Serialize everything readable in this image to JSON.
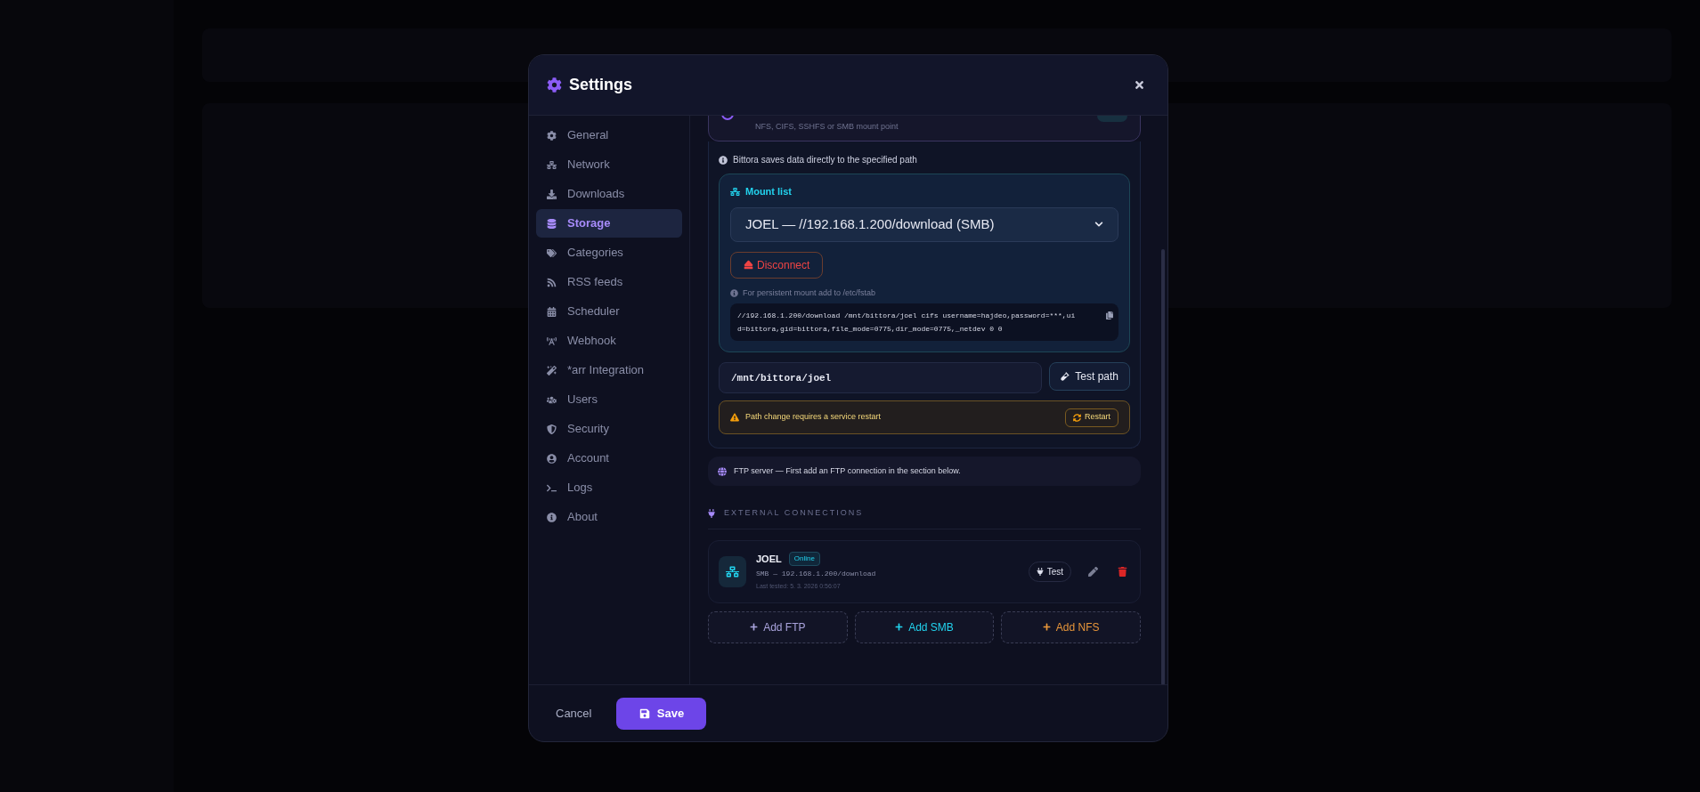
{
  "dialog": {
    "title": "Settings"
  },
  "sidebar": {
    "items": [
      {
        "label": "General",
        "selected": false
      },
      {
        "label": "Network",
        "selected": false
      },
      {
        "label": "Downloads",
        "selected": false
      },
      {
        "label": "Storage",
        "selected": true
      },
      {
        "label": "Categories",
        "selected": false
      },
      {
        "label": "RSS feeds",
        "selected": false
      },
      {
        "label": "Scheduler",
        "selected": false
      },
      {
        "label": "Webhook",
        "selected": false
      },
      {
        "label": "*arr Integration",
        "selected": false
      },
      {
        "label": "Users",
        "selected": false
      },
      {
        "label": "Security",
        "selected": false
      },
      {
        "label": "Account",
        "selected": false
      },
      {
        "label": "Logs",
        "selected": false
      },
      {
        "label": "About",
        "selected": false
      }
    ]
  },
  "storage": {
    "option_hint": "NFS, CIFS, SSHFS or SMB mount point",
    "info": "Bittora saves data directly to the specified path",
    "mount_list": {
      "title": "Mount list",
      "selected_mount": "JOEL — //192.168.1.200/download (SMB)",
      "disconnect": "Disconnect",
      "fstab_hint": "For persistent mount add to /etc/fstab",
      "fstab_line": "//192.168.1.200/download /mnt/bittora/joel cifs username=hajdeo,password=***,uid=bittora,gid=bittora,file_mode=0775,dir_mode=0775,_netdev 0 0"
    },
    "path": {
      "value": "/mnt/bittora/joel",
      "test_button": "Test path"
    },
    "warning": {
      "text": "Path change requires a service restart",
      "button": "Restart"
    },
    "ftp_option": "FTP server — First add an FTP connection in the section below."
  },
  "external": {
    "heading": "EXTERNAL CONNECTIONS",
    "connections": [
      {
        "name": "JOEL",
        "status": "Online",
        "detail": "SMB — 192.168.1.200/download",
        "last_tested": "Last tested: 5. 3. 2026 0:56:07",
        "test": "Test"
      }
    ],
    "add_buttons": [
      {
        "label": "Add FTP",
        "color": "#a9a3dc"
      },
      {
        "label": "Add SMB",
        "color": "#22d3ee"
      },
      {
        "label": "Add NFS",
        "color": "#e8963a"
      }
    ]
  },
  "footer": {
    "cancel": "Cancel",
    "save": "Save"
  }
}
